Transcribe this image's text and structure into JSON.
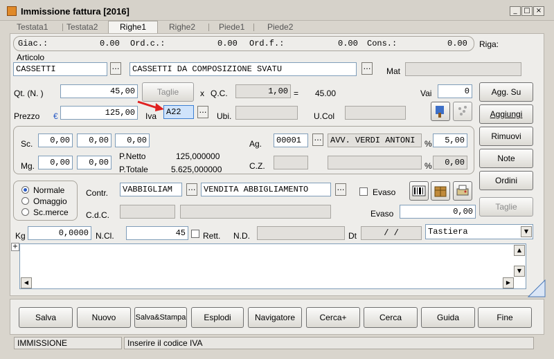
{
  "window": {
    "title": "Immissione fattura [2016]",
    "min": "_",
    "max": "□",
    "close": "×"
  },
  "tabs": [
    "Testata1",
    "Testata2",
    "Righe1",
    "Righe2",
    "Piede1",
    "Piede2"
  ],
  "info": {
    "giac_label": "Giac.:",
    "giac": "0.00",
    "ordc_label": "Ord.c.:",
    "ordc": "0.00",
    "ordf_label": "Ord.f.:",
    "ordf": "0.00",
    "cons_label": "Cons.:",
    "cons": "0.00",
    "riga_label": "Riga:"
  },
  "articolo": {
    "label": "Articolo",
    "code": "CASSETTI",
    "desc": "CASSETTI DA COMPOSIZIONE SVATU",
    "mat_label": "Mat"
  },
  "qty": {
    "label": "Qt. (N. )",
    "value": "45,00",
    "taglie_btn": "Taglie",
    "x": "x",
    "qc_label": "Q.C.",
    "qc": "1,00",
    "eq": "=",
    "result": "45.00",
    "vai_label": "Vai",
    "vai": "0"
  },
  "prezzo": {
    "label": "Prezzo",
    "currency": "€",
    "value": "125,00",
    "iva_label": "Iva",
    "iva": "A22",
    "ubi_label": "Ubi.",
    "ucol_label": "U.Col"
  },
  "sconti": {
    "sc_label": "Sc.",
    "sc": [
      "0,00",
      "0,00",
      "0,00"
    ],
    "mg_label": "Mg.",
    "mg": [
      "0,00",
      "0,00"
    ],
    "pnetto_label": "P.Netto",
    "pnetto": "125,000000",
    "ptotale_label": "P.Totale",
    "ptotale": "5.625,000000",
    "ag_label": "Ag.",
    "ag_code": "00001",
    "ag_name": "AVV. VERDI ANTONI",
    "pct": "%",
    "ag_pct": "5,00",
    "cz_label": "C.Z.",
    "cz_pct": "0,00"
  },
  "tipo": {
    "options": [
      "Normale",
      "Omaggio",
      "Sc.merce"
    ],
    "selected": 0,
    "contr_label": "Contr.",
    "contr_code": "VABBIGLIAM",
    "contr_desc": "VENDITA ABBIGLIAMENTO",
    "evaso_chk_label": "Evaso",
    "cdc_label": "C.d.C.",
    "evaso_label": "Evaso",
    "evaso_value": "0,00"
  },
  "bottom_row": {
    "kg_label": "Kg",
    "kg": "0,0000",
    "ncl_label": "N.Cl.",
    "ncl": "45",
    "rett_label": "Rett.",
    "nd_label": "N.D.",
    "dt_label": "Dt",
    "dt": "/   /",
    "input_mode": "Tastiera"
  },
  "notes": {
    "expand": "+"
  },
  "side_buttons": [
    "Agg. Su",
    "Aggiungi",
    "Rimuovi",
    "Note",
    "Ordini",
    "Taglie"
  ],
  "footer_buttons": [
    "Salva",
    "Nuovo",
    "Salva&Stampa",
    "Esplodi",
    "Navigatore",
    "Cerca+",
    "Cerca",
    "Guida",
    "Fine"
  ],
  "status": {
    "mode": "IMMISSIONE",
    "message": "Inserire il codice IVA"
  },
  "colors": {
    "accent": "#2a5bc4",
    "arrow": "#e02020",
    "focus": "#cfe3fb"
  }
}
